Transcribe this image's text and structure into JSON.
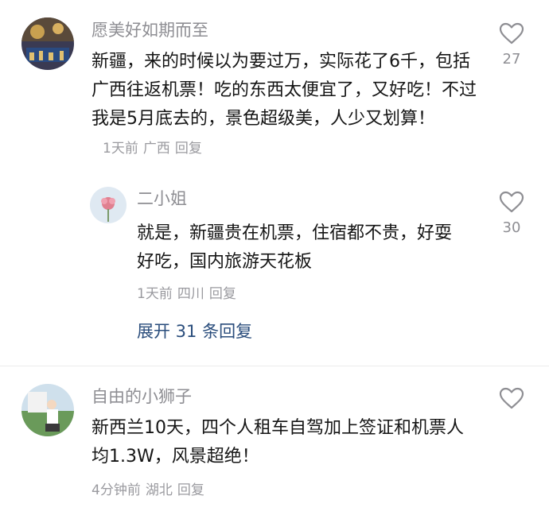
{
  "comments": [
    {
      "username": "愿美好如期而至",
      "text": "新疆，来的时候以为要过万，实际花了6千，包括广西往返机票！吃的东西太便宜了，又好吃！不过我是5月底去的，景色超级美，人少又划算！",
      "time": "1天前",
      "location": "广西",
      "reply_label": "回复",
      "likes": "27",
      "reply": {
        "username": "二小姐",
        "text": "就是，新疆贵在机票，住宿都不贵，好耍好吃，国内旅游天花板",
        "time": "1天前",
        "location": "四川",
        "reply_label": "回复",
        "likes": "30"
      },
      "expand_label": "展开 31 条回复"
    },
    {
      "username": "自由的小狮子",
      "text": "新西兰10天，四个人租车自驾加上签证和机票人均1.3W，风景超绝！",
      "time": "4分钟前",
      "location": "湖北",
      "reply_label": "回复",
      "likes": ""
    }
  ],
  "colors": {
    "username": "#8e8e93",
    "text": "#151515",
    "meta": "#9a9a9f",
    "link": "#2a4d7c"
  },
  "icons": {
    "like": "heart-outline-icon"
  }
}
